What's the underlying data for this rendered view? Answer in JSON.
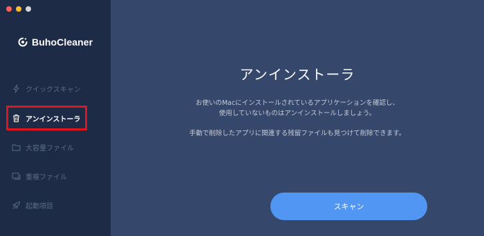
{
  "window": {
    "traffic_lights": {
      "close_color": "#fe5f57",
      "minimize_color": "#febc2e",
      "zoom_color": "#d6d6d6"
    }
  },
  "app": {
    "name": "BuhoCleaner",
    "logo_icon": "buho-logo-icon"
  },
  "sidebar": {
    "items": [
      {
        "label": "クイックスキャン",
        "icon": "lightning-icon",
        "active": false
      },
      {
        "label": "アンインストーラ",
        "icon": "trash-icon",
        "active": true
      },
      {
        "label": "大容量ファイル",
        "icon": "folder-icon",
        "active": false
      },
      {
        "label": "重複ファイル",
        "icon": "duplicate-icon",
        "active": false
      },
      {
        "label": "起動項目",
        "icon": "rocket-icon",
        "active": false
      }
    ]
  },
  "main": {
    "title": "アンインストーラ",
    "description_line1": "お使いのMacにインストールされているアプリケーションを確認し、",
    "description_line2": "使用していないものはアンインストールしましょう。",
    "description_line3": "手動で削除したアプリに関連する残留ファイルも見つけて削除できます。",
    "scan_button": "スキャン"
  },
  "colors": {
    "sidebar_bg": "#1e2b47",
    "main_bg": "#36476c",
    "accent": "#5096f2",
    "highlight": "#e2151d"
  }
}
